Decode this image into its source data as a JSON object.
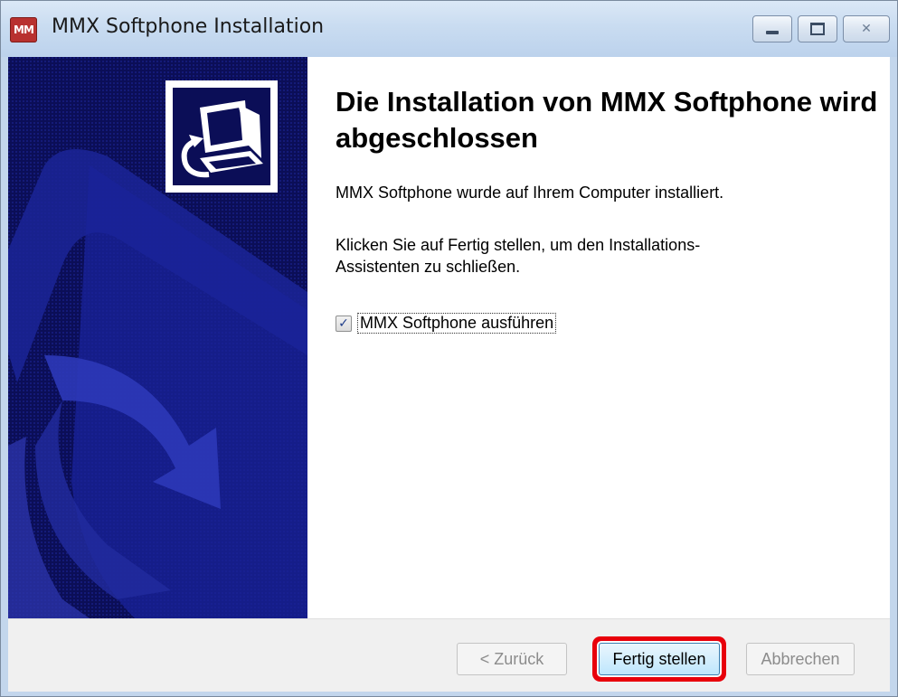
{
  "window": {
    "title": "MMX Softphone Installation",
    "app_icon_text": "MM",
    "controls": {
      "minimize": "minimize-icon",
      "maximize": "maximize-icon",
      "close": "close-icon",
      "close_glyph": "✕"
    }
  },
  "banner": {
    "logo_icon": "computer-install-icon",
    "colors": {
      "banner": "#0b0e57",
      "highlight": "#e8000b"
    }
  },
  "main": {
    "title": "Die Installation von MMX Softphone wird abgeschlossen",
    "installed_text": "MMX Softphone wurde auf Ihrem Computer installiert.",
    "instruction_text": "Klicken Sie auf Fertig stellen, um den Installations-Assistenten zu schließen.",
    "run_checkbox": {
      "label": "MMX Softphone ausführen",
      "checked": true,
      "glyph": "✓"
    }
  },
  "footer": {
    "back_label": "< Zurück",
    "finish_label": "Fertig stellen",
    "cancel_label": "Abbrechen"
  }
}
